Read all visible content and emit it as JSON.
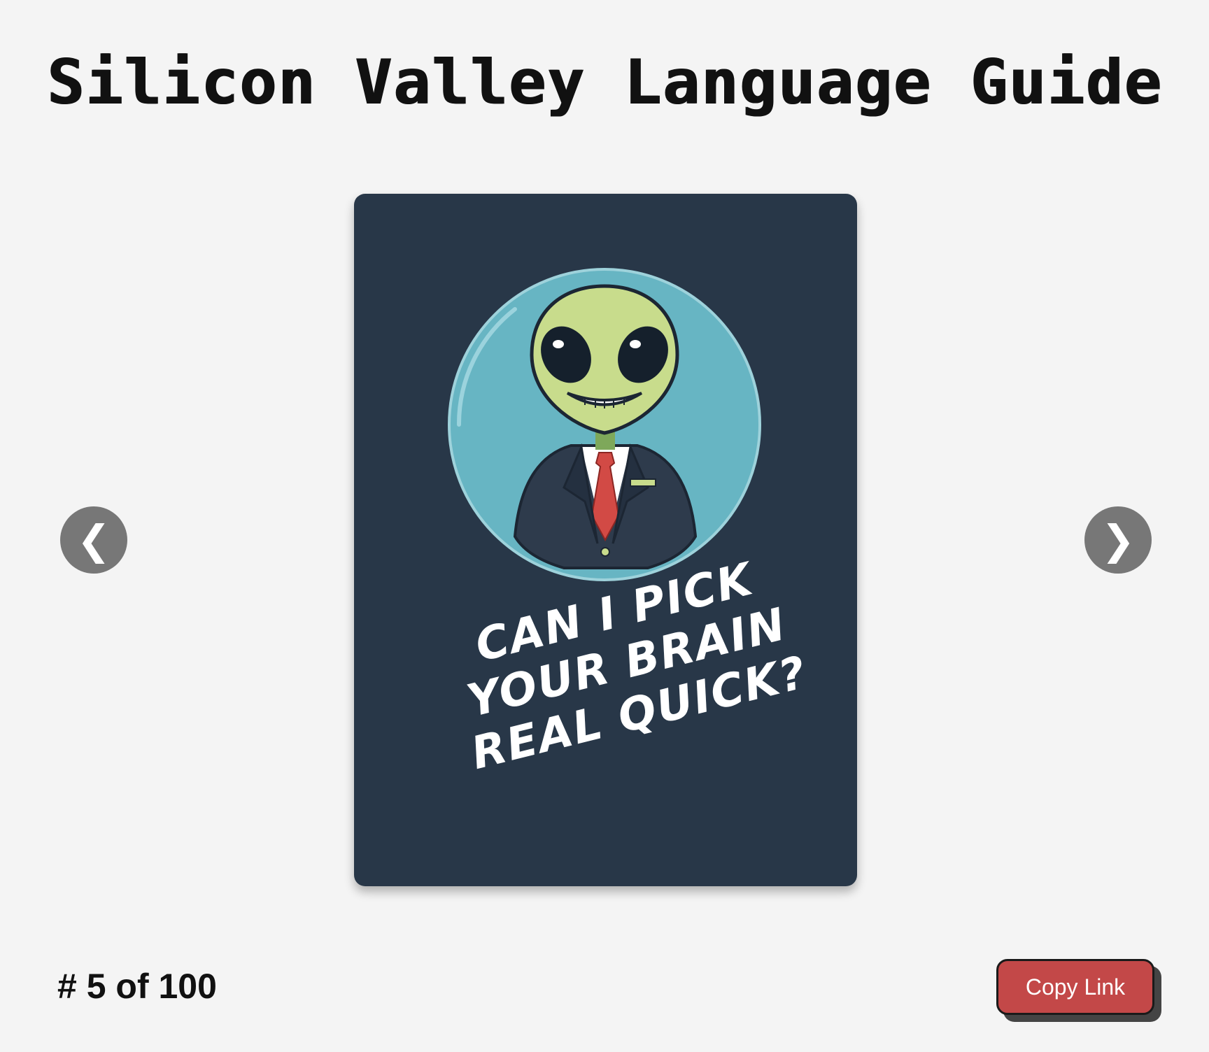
{
  "header": {
    "title": "Silicon Valley Language Guide"
  },
  "card": {
    "caption_lines": [
      "CAN I PICK",
      "YOUR BRAIN",
      "REAL QUICK?"
    ],
    "colors": {
      "background": "#283748",
      "circle": "#67b5c3",
      "alien_skin": "#c8dc8c",
      "suit": "#2e3b4c",
      "tie": "#d24a45",
      "shirt": "#ffffff"
    }
  },
  "navigation": {
    "prev_icon": "chevron-left-icon",
    "prev_label": "❮",
    "next_icon": "chevron-right-icon",
    "next_label": "❯"
  },
  "footer": {
    "counter_text": "# 5 of 100",
    "copy_button_label": "Copy Link",
    "copy_button_color": "#c34848"
  }
}
